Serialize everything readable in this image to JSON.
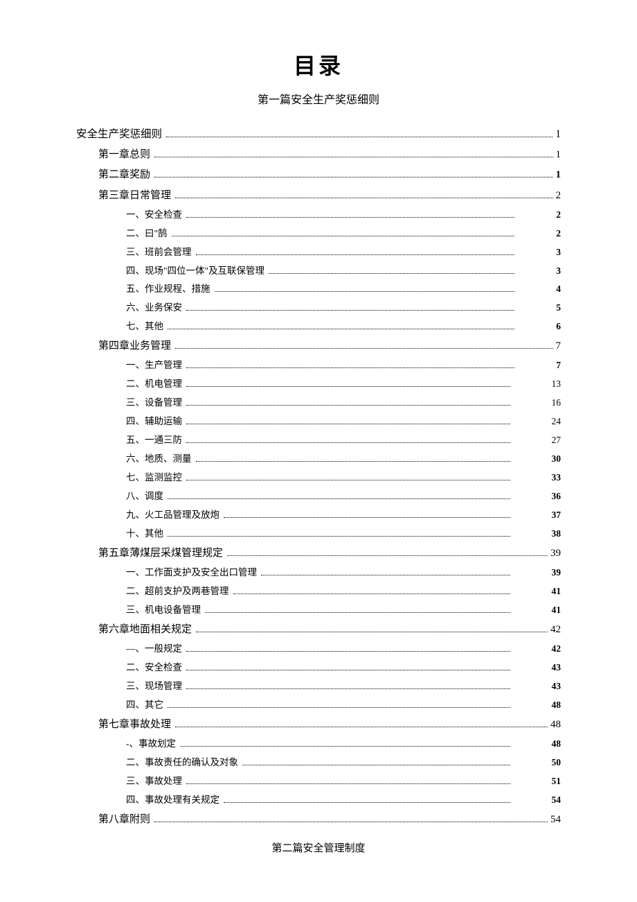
{
  "title": "目录",
  "subtitle": "第一篇安全生产奖惩细则",
  "entries": [
    {
      "level": 0,
      "label": "安全生产奖惩细则",
      "page": "1",
      "bold": false
    },
    {
      "level": 1,
      "label": "第一章总则",
      "page": "1",
      "bold": false
    },
    {
      "level": 1,
      "label": "第二章奖励",
      "page": "1",
      "bold": true
    },
    {
      "level": 1,
      "label": "第三章日常管理",
      "page": "2",
      "bold": false
    },
    {
      "level": 2,
      "label": "一、安全检查",
      "page": "2",
      "bold": true
    },
    {
      "level": 2,
      "label": "二、曰\"鹄",
      "page": "2",
      "bold": true
    },
    {
      "level": 2,
      "label": "三、班前会管理",
      "page": "3",
      "bold": true
    },
    {
      "level": 2,
      "label": "四、现场\"四位一体\"及互联保管理",
      "page": "3",
      "bold": true
    },
    {
      "level": 2,
      "label": "五、作业规程、措施",
      "page": "4",
      "bold": true
    },
    {
      "level": 2,
      "label": "六、业务保安",
      "page": "5",
      "bold": true
    },
    {
      "level": 2,
      "label": "七、其他",
      "page": "6",
      "bold": true
    },
    {
      "level": 1,
      "label": "第四章业务管理",
      "page": "7",
      "bold": false
    },
    {
      "level": 2,
      "label": "一、生产管理",
      "page": "7",
      "bold": true
    },
    {
      "level": 2,
      "label": "二、机电管理",
      "page": "13",
      "bold": false
    },
    {
      "level": 2,
      "label": "三、设备管理",
      "page": "16",
      "bold": false
    },
    {
      "level": 2,
      "label": "四、辅助运输",
      "page": "24",
      "bold": false
    },
    {
      "level": 2,
      "label": "五、一通三防",
      "page": "27",
      "bold": false
    },
    {
      "level": 2,
      "label": "六、地质、测量",
      "page": "30",
      "bold": true
    },
    {
      "level": 2,
      "label": "七、监测监控",
      "page": "33",
      "bold": true
    },
    {
      "level": 2,
      "label": "八、调度",
      "page": "36",
      "bold": true
    },
    {
      "level": 2,
      "label": "九、火工品管理及放炮",
      "page": "37",
      "bold": true
    },
    {
      "level": 2,
      "label": "十、其他",
      "page": "38",
      "bold": true
    },
    {
      "level": 1,
      "label": "第五章薄煤层采煤管理规定",
      "page": "39",
      "bold": false
    },
    {
      "level": 2,
      "label": "一、工作面支护及安全出口管理",
      "page": "39",
      "bold": true
    },
    {
      "level": 2,
      "label": "二、超前支护及两巷管理",
      "page": "41",
      "bold": true
    },
    {
      "level": 2,
      "label": "三、机电设备管理",
      "page": "41",
      "bold": true
    },
    {
      "level": 1,
      "label": "第六章地面相关规定",
      "page": "42",
      "bold": false
    },
    {
      "level": 2,
      "label": "―、一般规定",
      "page": "42",
      "bold": true
    },
    {
      "level": 2,
      "label": "二、安全检查",
      "page": "43",
      "bold": true
    },
    {
      "level": 2,
      "label": "三、现场管理",
      "page": "43",
      "bold": true
    },
    {
      "level": 2,
      "label": "四、其它",
      "page": "48",
      "bold": true
    },
    {
      "level": 1,
      "label": "第七章事故处理",
      "page": "48",
      "bold": false
    },
    {
      "level": 2,
      "label": "-、事故划定",
      "page": "48",
      "bold": true
    },
    {
      "level": 2,
      "label": "二、事故责任的确认及对象",
      "page": "50",
      "bold": true
    },
    {
      "level": 2,
      "label": "三、事故处理",
      "page": "51",
      "bold": true
    },
    {
      "level": 2,
      "label": "四、事故处理有关规定",
      "page": "54",
      "bold": true
    },
    {
      "level": 1,
      "label": "第八章附则",
      "page": "54",
      "bold": false
    }
  ],
  "section2": "第二篇安全管理制度"
}
